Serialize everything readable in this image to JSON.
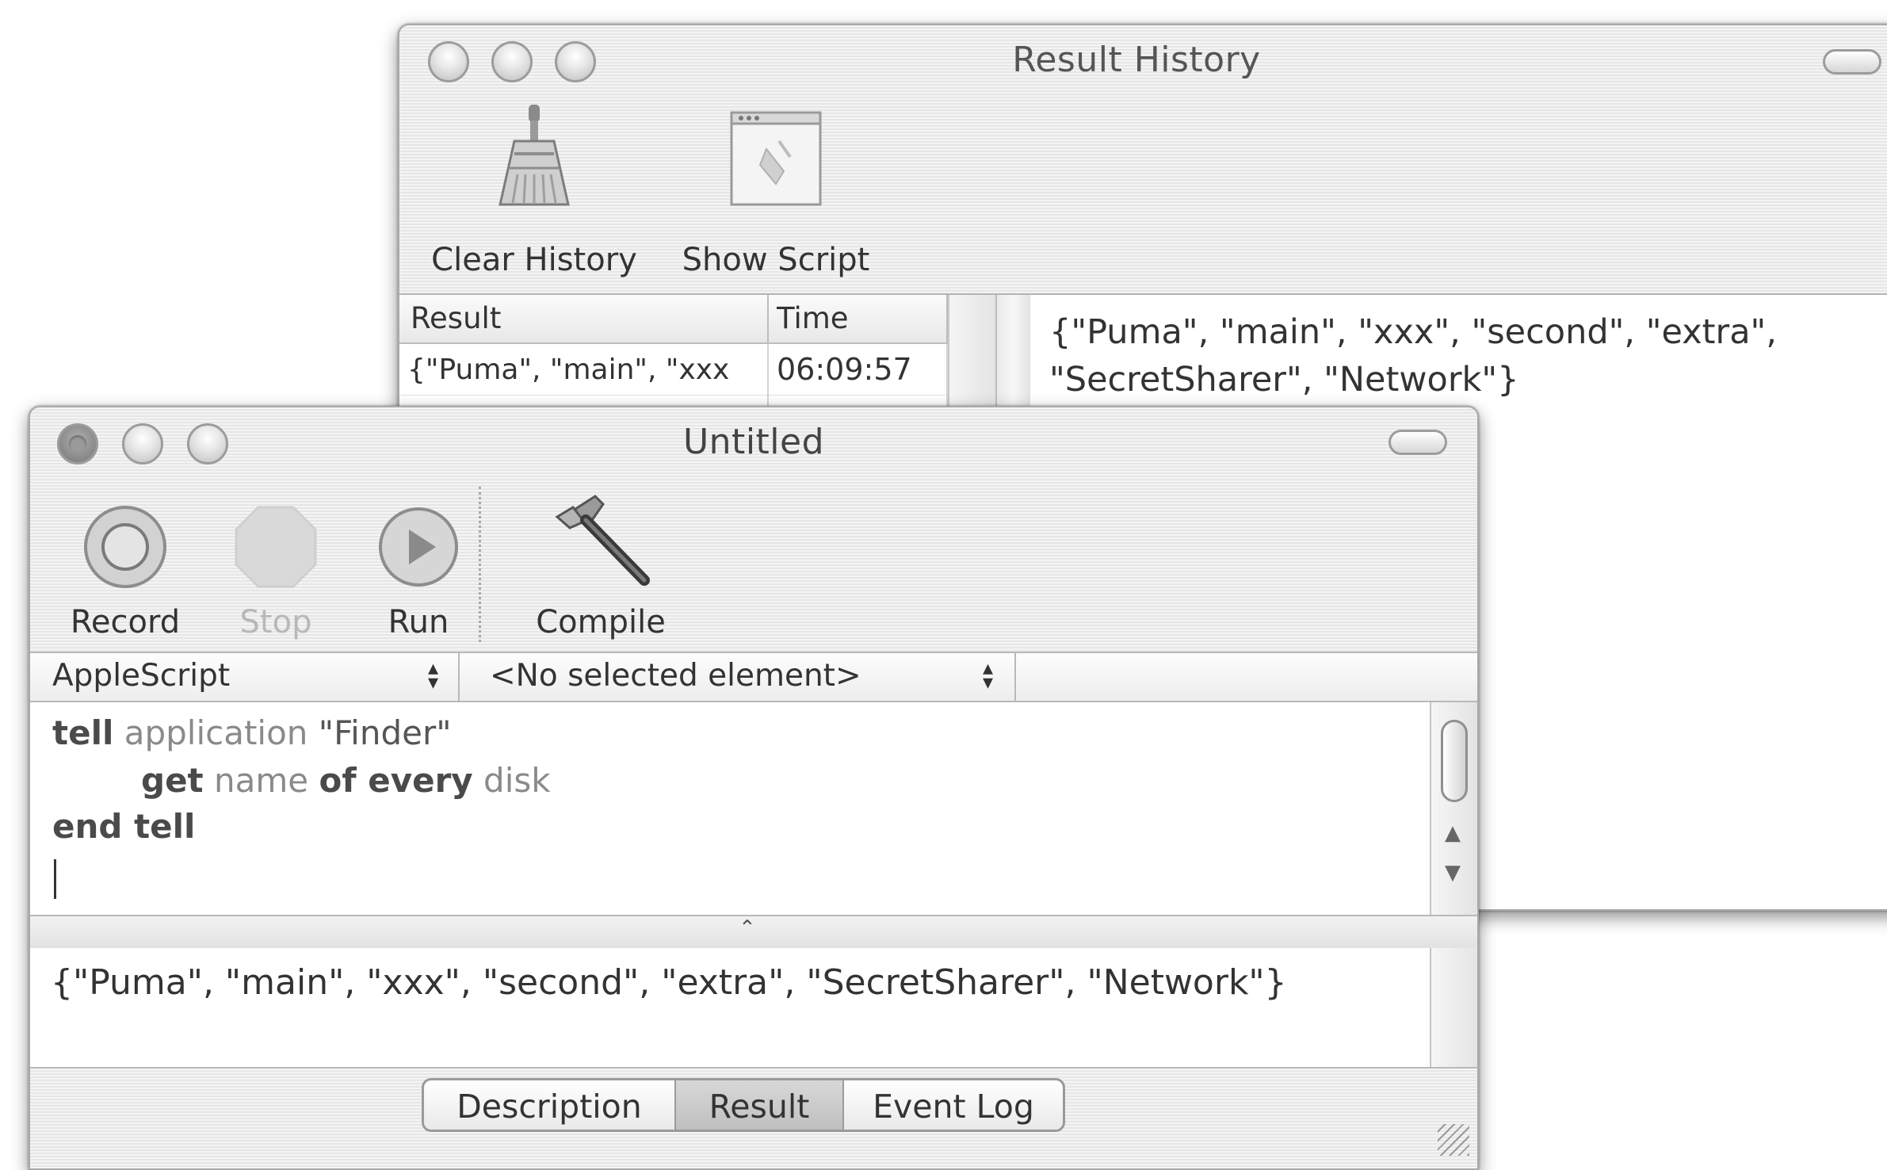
{
  "result_history": {
    "title": "Result History",
    "toolbar": {
      "clear_history_label": "Clear History",
      "show_script_label": "Show Script"
    },
    "table": {
      "columns": [
        "Result",
        "Time"
      ],
      "rows": [
        {
          "result": "{\"Puma\", \"main\", \"xxx",
          "time": "06:09:57"
        }
      ]
    },
    "detail_lines": [
      "{\"Puma\", \"main\", \"xxx\", \"second\", \"extra\",",
      "\"SecretSharer\", \"Network\"}"
    ]
  },
  "editor_window": {
    "title": "Untitled",
    "toolbar": {
      "record_label": "Record",
      "stop_label": "Stop",
      "run_label": "Run",
      "compile_label": "Compile"
    },
    "language_popup": "AppleScript",
    "element_popup": "<No selected element>",
    "script": {
      "line1": {
        "kw": "tell",
        "ident": "application",
        "str": "\"Finder\""
      },
      "line2": {
        "kw1": "get",
        "ident1": "name",
        "kw2": "of every",
        "ident2": "disk"
      },
      "line3": {
        "kw": "end tell"
      }
    },
    "result_text": "{\"Puma\", \"main\", \"xxx\", \"second\", \"extra\", \"SecretSharer\", \"Network\"}",
    "tabs": [
      "Description",
      "Result",
      "Event Log"
    ],
    "selected_tab": "Result"
  }
}
